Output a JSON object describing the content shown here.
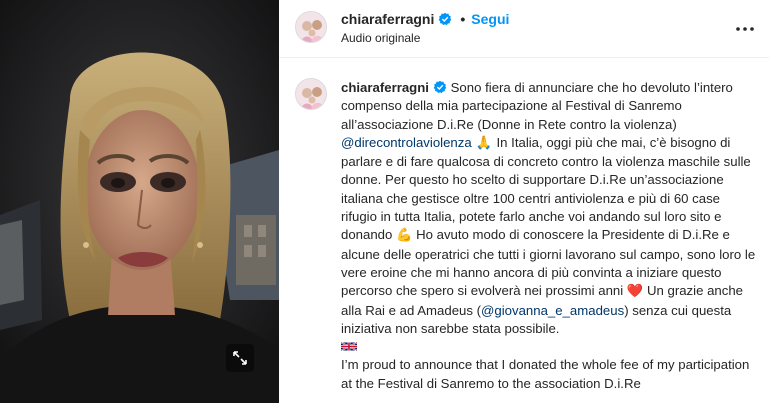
{
  "header": {
    "username": "chiaraferragni",
    "verified": true,
    "separator": "•",
    "follow_label": "Segui",
    "audio_label": "Audio originale",
    "more_icon": "more-horizontal-icon"
  },
  "media": {
    "type": "video",
    "expand_icon": "expand-arrows-icon"
  },
  "caption": {
    "username": "chiaraferragni",
    "part1": " Sono fiera di annunciare che ho devoluto l’intero compenso della mia partecipazione al Festival di Sanremo all’associazione D.i.Re (Donne in Rete contro la violenza) ",
    "mention1": "@direcontrolaviolenza",
    "emoji1": " 🙏 ",
    "part2": "In Italia, oggi più che mai, c’è bisogno di parlare e di fare qualcosa di concreto contro la violenza maschile sulle donne. Per questo ho scelto di supportare D.i.Re un’associazione italiana che gestisce oltre 100 centri antiviolenza e più di 60 case rifugio in tutta Italia, potete farlo anche voi andando sul loro sito e donando ",
    "emoji2": "💪",
    "part3": " Ho avuto modo di conoscere la Presidente di D.i.Re e alcune delle operatrici che tutti i giorni lavorano sul campo, sono loro le vere eroine che mi hanno ancora di più convinta a iniziare questo percorso che spero si evolverà nei prossimi anni ",
    "emoji3": "❤️",
    "part4": " Un grazie anche alla Rai e ad Amadeus (",
    "mention2": "@giovanna_e_amadeus",
    "part5": ") senza cui questa iniziativa non sarebbe stata possibile.",
    "flag_icon": "uk-flag-icon",
    "english": "I’m proud to announce that I donated the whole fee of my participation at the Festival di Sanremo to the association D.i.Re"
  },
  "colors": {
    "link_blue": "#0095f6",
    "mention": "#00376b",
    "verified_badge": "#0095f6",
    "heart": "#e0245e",
    "media_bg": "#000000"
  }
}
